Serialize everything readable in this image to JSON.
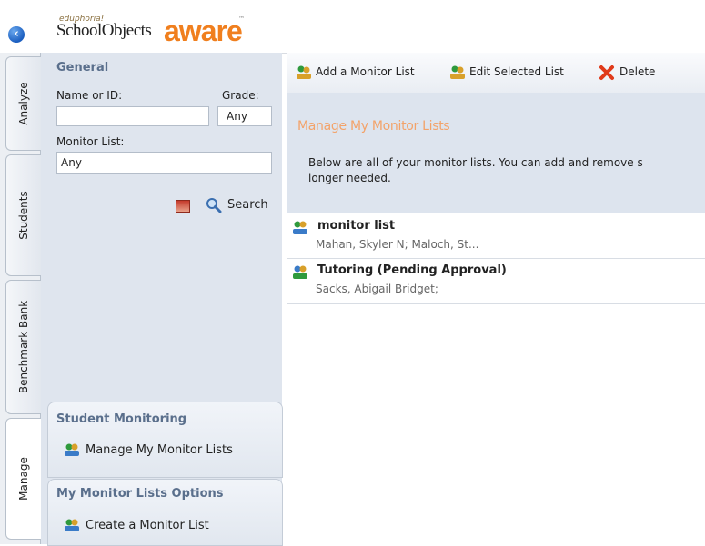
{
  "header": {
    "logo_small": "eduphoria!",
    "logo_school": "SchoolObjects",
    "logo_aware": "aware",
    "logo_tm": "™"
  },
  "tabs": [
    {
      "label": "Analyze"
    },
    {
      "label": "Students"
    },
    {
      "label": "Benchmark Bank"
    },
    {
      "label": "Manage"
    }
  ],
  "left_panel": {
    "general_title": "General",
    "name_label": "Name or ID:",
    "name_value": "",
    "grade_label": "Grade:",
    "grade_value": "Any",
    "monitor_label": "Monitor List:",
    "monitor_value": "Any",
    "search_label": "Search",
    "student_monitoring": {
      "title": "Student Monitoring",
      "item": "Manage My Monitor Lists"
    },
    "monitor_options": {
      "title": "My Monitor Lists Options",
      "item": "Create a Monitor List"
    }
  },
  "toolbar": {
    "add_label": "Add a Monitor List",
    "edit_label": "Edit Selected List",
    "delete_label": "Delete"
  },
  "main": {
    "title": "Manage My Monitor Lists",
    "desc_line1": "Below are all of your monitor lists. You can add and remove s",
    "desc_line2": "longer needed.",
    "lists": [
      {
        "name": "monitor list",
        "members": "Mahan, Skyler N; Maloch, St..."
      },
      {
        "name": "Tutoring (Pending Approval)",
        "members": "Sacks, Abigail Bridget;"
      }
    ]
  },
  "colors": {
    "accent_orange": "#f07f1e",
    "panel_blue": "#dfe5ee",
    "section_title": "#5a6f8c"
  }
}
